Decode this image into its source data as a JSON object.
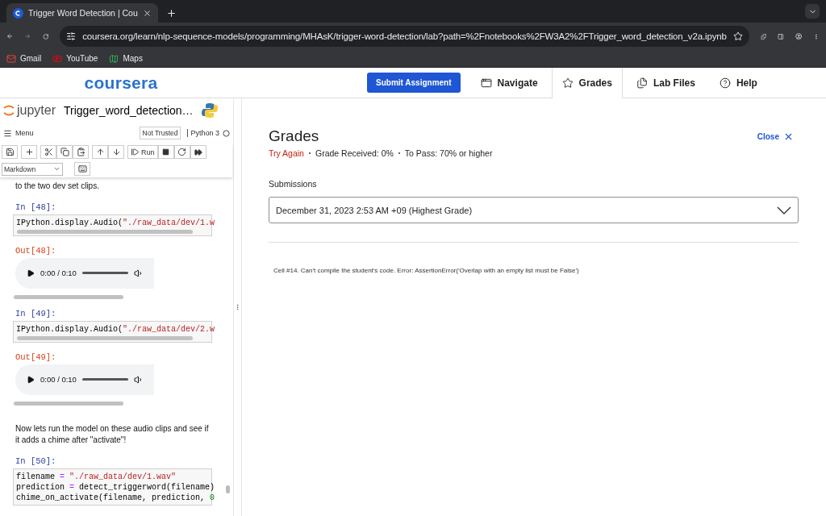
{
  "browser": {
    "tab_title": "Trigger Word Detection | Cou",
    "url": "coursera.org/learn/nlp-sequence-models/programming/MHAsK/trigger-word-detection/lab?path=%2Fnotebooks%2FW3A2%2FTrigger_word_detection_v2a.ipynb",
    "bookmarks": [
      {
        "label": "Gmail",
        "kind": "mail"
      },
      {
        "label": "YouTube",
        "kind": "video"
      },
      {
        "label": "Maps",
        "kind": "map"
      }
    ]
  },
  "header": {
    "logo": "coursera",
    "submit": "Submit Assignment",
    "nav": [
      {
        "label": "Navigate",
        "kind": "window",
        "selected": false
      },
      {
        "label": "Grades",
        "kind": "star",
        "selected": true
      },
      {
        "label": "Lab Files",
        "kind": "files",
        "selected": false
      },
      {
        "label": "Help",
        "kind": "help",
        "selected": false
      }
    ]
  },
  "jupyter": {
    "logo": "jupyter",
    "title": "Trigger_word_detection…",
    "menu": "Menu",
    "trusted": "Not Trusted",
    "kernel": "Python 3",
    "run": "Run",
    "cell_type": "Markdown",
    "cells": [
      {
        "kind": "text",
        "text": "to the two dev set clips."
      },
      {
        "kind": "code",
        "prompt": "In [48]:",
        "lines": [
          [
            {
              "t": "IPython.display.Audio(",
              "kind": "plain"
            },
            {
              "t": "\"./raw_data/dev/1.w",
              "kind": "string"
            }
          ]
        ]
      },
      {
        "kind": "audio",
        "prompt": "Out[48]:",
        "time": "0:00 / 0:10"
      },
      {
        "kind": "code",
        "prompt": "In [49]:",
        "lines": [
          [
            {
              "t": "IPython.display.Audio(",
              "kind": "plain"
            },
            {
              "t": "\"./raw_data/dev/2.w",
              "kind": "string"
            }
          ]
        ]
      },
      {
        "kind": "audio",
        "prompt": "Out[49]:",
        "time": "0:00 / 0:10"
      },
      {
        "kind": "text",
        "text": "Now lets run the model on these audio clips and see if it adds a chime after \"activate\"!"
      },
      {
        "kind": "code",
        "prompt": "In [50]:",
        "lines": [
          [
            {
              "t": "filename ",
              "kind": "plain"
            },
            {
              "t": "=",
              "kind": "op"
            },
            {
              "t": " \"./raw_data/dev/1.wav\"",
              "kind": "string"
            }
          ],
          [
            {
              "t": "prediction ",
              "kind": "plain"
            },
            {
              "t": "=",
              "kind": "op"
            },
            {
              "t": " detect_triggerword(filename)",
              "kind": "plain"
            }
          ],
          [
            {
              "t": "chime_on_activate(filename, prediction, ",
              "kind": "plain"
            },
            {
              "t": "0",
              "kind": "number"
            }
          ]
        ]
      }
    ]
  },
  "grades": {
    "title": "Grades",
    "status": "Try Again",
    "received": "Grade Received: 0%",
    "to_pass": "To Pass: 70% or higher",
    "close": "Close",
    "submissions_label": "Submissions",
    "submission": "December 31, 2023 2:53 AM +09 (Highest Grade)",
    "feedback": "Cell #14. Can't compile the student's code. Error: AssertionError('Overlap with an empty list must be False')"
  }
}
